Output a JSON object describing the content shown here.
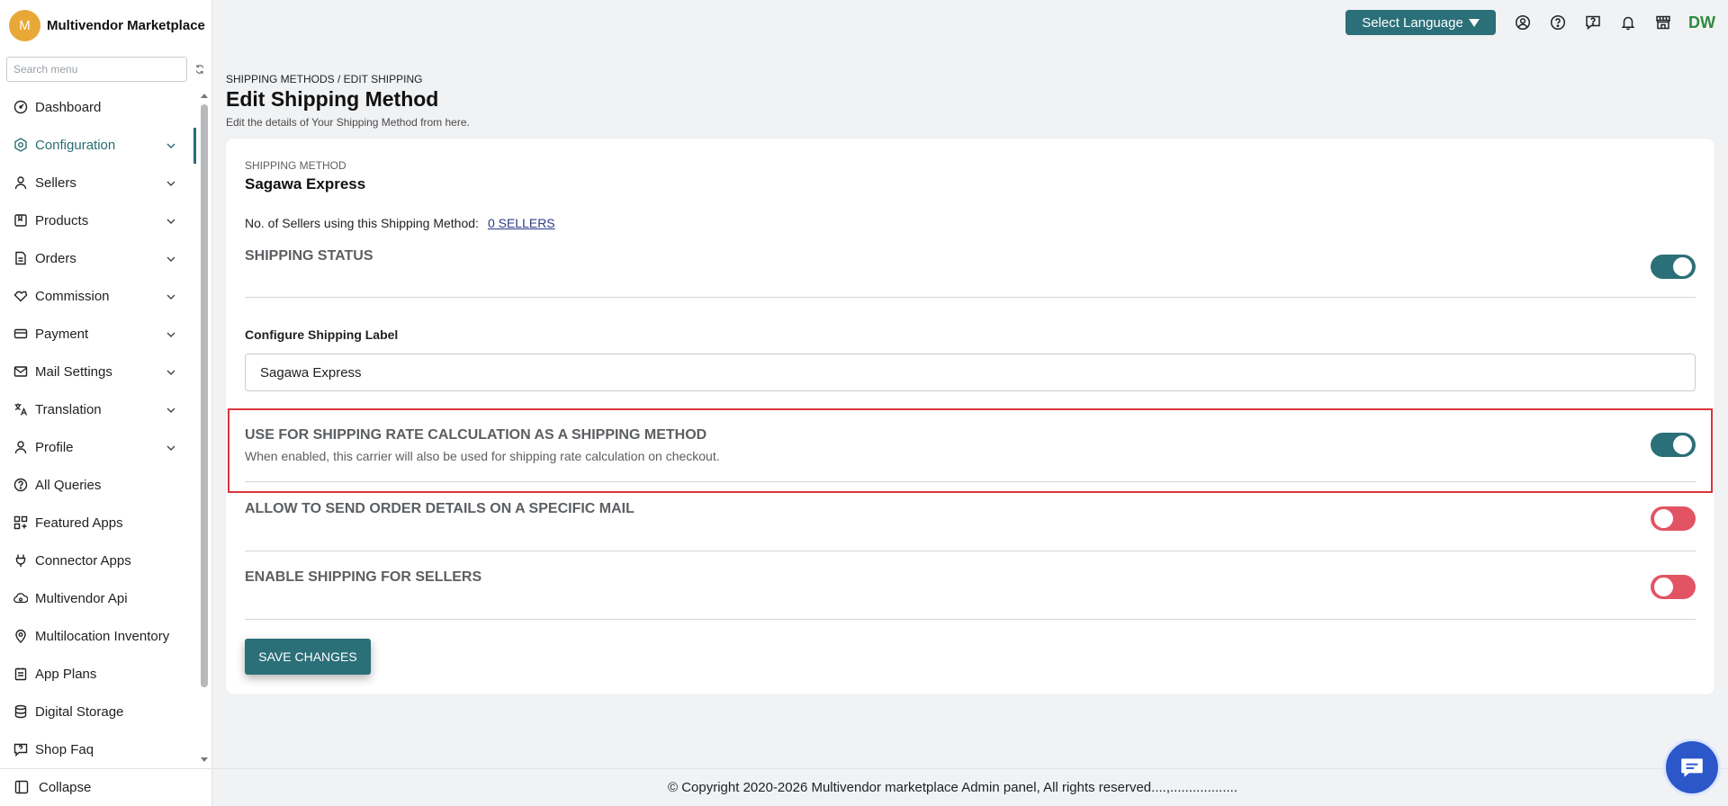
{
  "brand": {
    "initial": "M",
    "name": "Multivendor Marketplace"
  },
  "sidebar": {
    "search_placeholder": "Search menu",
    "items": [
      {
        "label": "Dashboard",
        "icon": "gauge-icon",
        "chevron": false
      },
      {
        "label": "Configuration",
        "icon": "config-icon",
        "chevron": true,
        "active": true
      },
      {
        "label": "Sellers",
        "icon": "user-icon",
        "chevron": true
      },
      {
        "label": "Products",
        "icon": "product-icon",
        "chevron": true
      },
      {
        "label": "Orders",
        "icon": "order-icon",
        "chevron": true
      },
      {
        "label": "Commission",
        "icon": "commission-icon",
        "chevron": true
      },
      {
        "label": "Payment",
        "icon": "payment-icon",
        "chevron": true
      },
      {
        "label": "Mail Settings",
        "icon": "mail-icon",
        "chevron": true
      },
      {
        "label": "Translation",
        "icon": "translate-icon",
        "chevron": true
      },
      {
        "label": "Profile",
        "icon": "profile-icon",
        "chevron": true
      },
      {
        "label": "All Queries",
        "icon": "question-icon",
        "chevron": false
      },
      {
        "label": "Featured Apps",
        "icon": "apps-icon",
        "chevron": false
      },
      {
        "label": "Connector Apps",
        "icon": "plug-icon",
        "chevron": false
      },
      {
        "label": "Multivendor Api",
        "icon": "api-icon",
        "chevron": false
      },
      {
        "label": "Multilocation Inventory",
        "icon": "location-icon",
        "chevron": false
      },
      {
        "label": "App Plans",
        "icon": "plans-icon",
        "chevron": false
      },
      {
        "label": "Digital Storage",
        "icon": "database-icon",
        "chevron": false
      },
      {
        "label": "Shop Faq",
        "icon": "faq-icon",
        "chevron": false
      }
    ],
    "collapse_label": "Collapse"
  },
  "topbar": {
    "language_label": "Select Language",
    "initials": "DW"
  },
  "page": {
    "breadcrumb": "SHIPPING METHODS / EDIT SHIPPING",
    "title": "Edit Shipping Method",
    "subtitle": "Edit the details of Your Shipping Method from here."
  },
  "card": {
    "eyebrow": "SHIPPING METHOD",
    "method_name": "Sagawa Express",
    "sellers_prefix": "No. of Sellers using this Shipping Method:",
    "sellers_link": "0 SELLERS",
    "shipping_status_title": "SHIPPING STATUS",
    "shipping_status_on": true,
    "label_field_title": "Configure Shipping Label",
    "label_field_value": "Sagawa Express",
    "rate_calc_title": "USE FOR SHIPPING RATE CALCULATION AS A SHIPPING METHOD",
    "rate_calc_desc": "When enabled, this carrier will also be used for shipping rate calculation on checkout.",
    "rate_calc_on": true,
    "order_mail_title": "ALLOW TO SEND ORDER DETAILS ON A SPECIFIC MAIL",
    "order_mail_on": false,
    "sellers_shipping_title": "ENABLE SHIPPING FOR SELLERS",
    "sellers_shipping_on": false,
    "save_label": "SAVE CHANGES"
  },
  "footer": {
    "text": "© Copyright 2020-2026 Multivendor marketplace Admin panel, All rights reserved....,.................."
  },
  "colors": {
    "accent": "#2b6f78",
    "toggle_off": "#e25463",
    "highlight": "#d9353a",
    "initials": "#2f8a3c"
  }
}
